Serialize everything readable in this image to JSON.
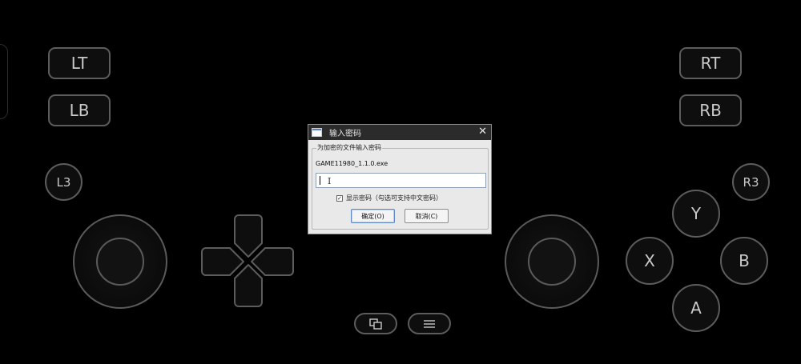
{
  "gamepad": {
    "lt": "LT",
    "lb": "LB",
    "rt": "RT",
    "rb": "RB",
    "l3": "L3",
    "r3": "R3",
    "y": "Y",
    "x": "X",
    "b": "B",
    "a": "A"
  },
  "dialog": {
    "title": "输入密码",
    "close": "✕",
    "group_label": "为加密的文件输入密码",
    "filename": "GAME11980_1.1.0.exe",
    "password_value": "",
    "show_password_checked": "✓",
    "show_password_label": "显示密码（勾选可支持中文密码）",
    "ok_label": "确定(O)",
    "cancel_label": "取消(C)"
  },
  "colors": {
    "background": "#000000",
    "control_border": "#5c5c5c",
    "dialog_bg": "#e9e9e9",
    "titlebar_bg": "#2b2b2b"
  }
}
